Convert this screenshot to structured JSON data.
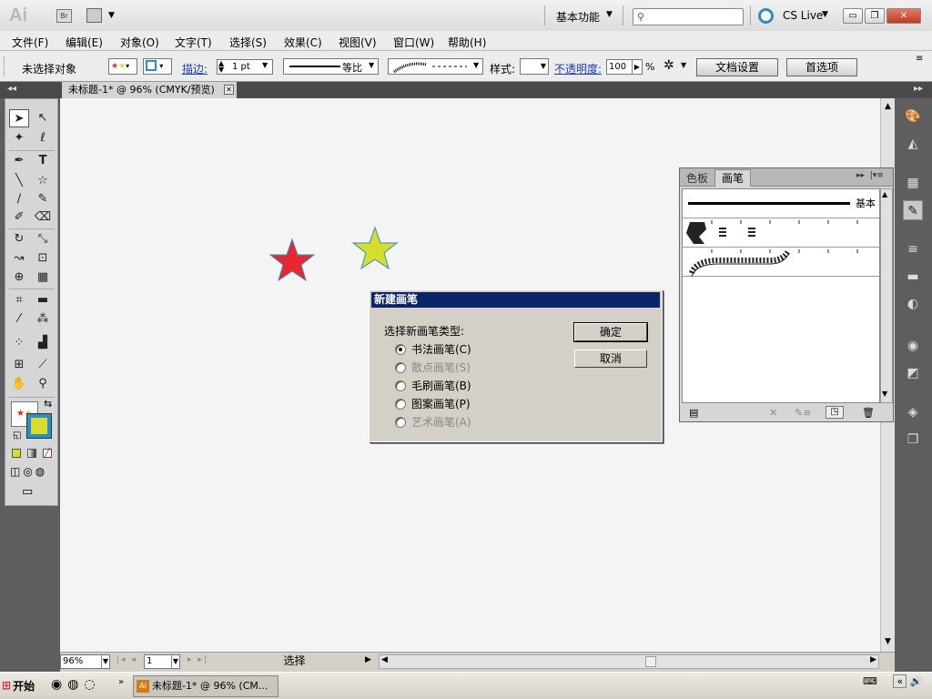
{
  "app": {
    "logo": "Ai",
    "bridge": "Br",
    "workspace": "基本功能",
    "search_icon": "search-icon",
    "cslive": "CS Live"
  },
  "window_buttons": {
    "minimize": "▭",
    "restore": "❐",
    "close": "✕"
  },
  "menu": [
    "文件(F)",
    "编辑(E)",
    "对象(O)",
    "文字(T)",
    "选择(S)",
    "效果(C)",
    "视图(V)",
    "窗口(W)",
    "帮助(H)"
  ],
  "control": {
    "no_selection": "未选择对象",
    "stroke_label": "描边:",
    "stroke_value": "1 pt",
    "uniform": "等比",
    "style_label": "样式:",
    "opacity_label": "不透明度:",
    "opacity_value": "100",
    "opacity_unit": "%",
    "doc_setup": "文档设置",
    "preferences": "首选项"
  },
  "document_tab": {
    "title": "未标题-1* @ 96% (CMYK/预览)",
    "close": "✕"
  },
  "colors": {
    "accent_blue": "#2a8ec8",
    "star_red": "#e8262d",
    "star_yellow": "#d8dc2a",
    "dialog_title": "#0a246a"
  },
  "brushes_panel": {
    "tab_swatches": "色板",
    "tab_brushes": "画笔",
    "basic_label": "基本"
  },
  "dialog": {
    "title": "新建画笔",
    "prompt": "选择新画笔类型:",
    "options": [
      {
        "label": "书法画笔(C)",
        "selected": true,
        "enabled": true
      },
      {
        "label": "散点画笔(S)",
        "selected": false,
        "enabled": false
      },
      {
        "label": "毛刷画笔(B)",
        "selected": false,
        "enabled": true
      },
      {
        "label": "图案画笔(P)",
        "selected": false,
        "enabled": true
      },
      {
        "label": "艺术画笔(A)",
        "selected": false,
        "enabled": false
      }
    ],
    "ok": "确定",
    "cancel": "取消"
  },
  "status": {
    "zoom": "96%",
    "page": "1",
    "mode": "选择"
  },
  "taskbar": {
    "start": "开始",
    "item": "未标题-1* @ 96% (CM..."
  }
}
